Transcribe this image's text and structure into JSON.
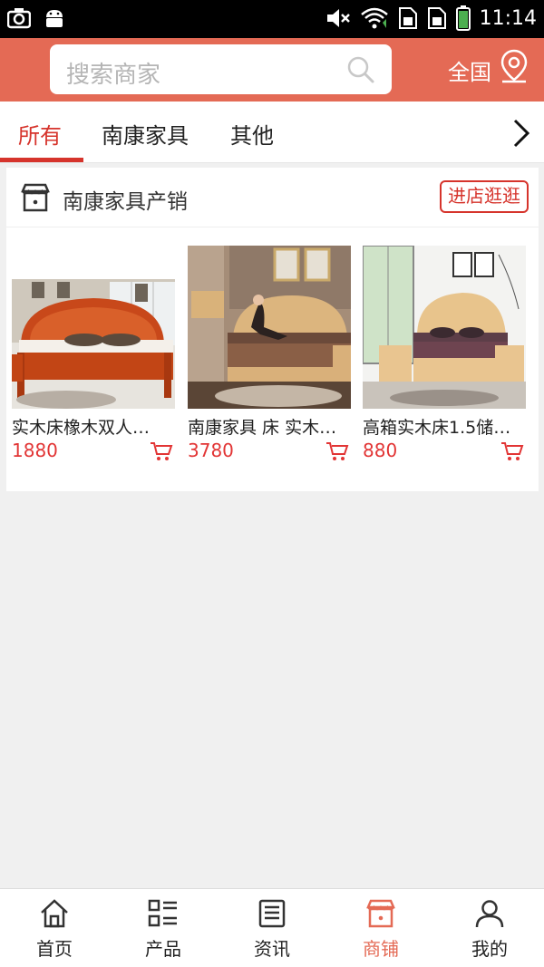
{
  "status_bar": {
    "time": "11:14"
  },
  "header": {
    "search_placeholder": "搜索商家",
    "region": "全国"
  },
  "tabs": [
    {
      "label": "所有",
      "active": true
    },
    {
      "label": "南康家具",
      "active": false
    },
    {
      "label": "其他",
      "active": false
    }
  ],
  "shop": {
    "name": "南康家具产销",
    "visit_label": "进店逛逛",
    "products": [
      {
        "title": "实木床橡木双人…",
        "price": "1880"
      },
      {
        "title": "南康家具 床 实木…",
        "price": "3780"
      },
      {
        "title": "高箱实木床1.5储…",
        "price": "880"
      }
    ]
  },
  "bottom_nav": [
    {
      "label": "首页",
      "icon": "home-icon"
    },
    {
      "label": "产品",
      "icon": "list-icon"
    },
    {
      "label": "资讯",
      "icon": "news-icon"
    },
    {
      "label": "商铺",
      "icon": "shop-icon",
      "active": true
    },
    {
      "label": "我的",
      "icon": "user-icon"
    }
  ],
  "colors": {
    "brand": "#e46a55",
    "accent_red": "#d6342c",
    "price": "#e23535"
  }
}
